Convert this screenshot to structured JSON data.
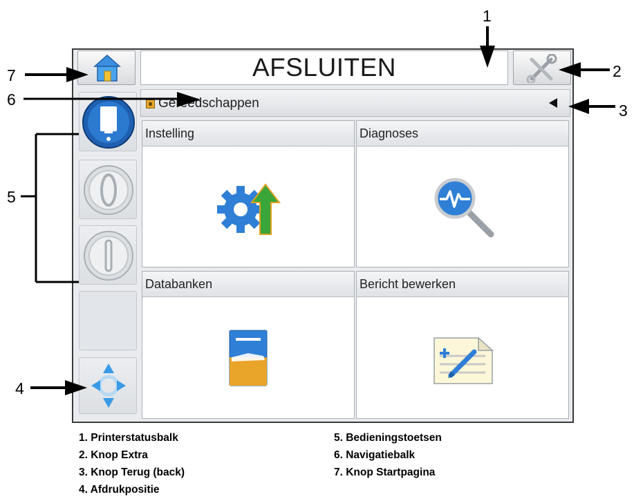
{
  "status_bar": {
    "title": "AFSLUITEN"
  },
  "nav_bar": {
    "breadcrumb": "Gereedschappen"
  },
  "tiles": [
    {
      "label": "Instelling"
    },
    {
      "label": "Diagnoses"
    },
    {
      "label": "Databanken"
    },
    {
      "label": "Bericht bewerken"
    }
  ],
  "callouts": [
    "1",
    "2",
    "3",
    "4",
    "5",
    "6",
    "7"
  ],
  "legend": [
    "1. Printerstatusbalk",
    "2. Knop Extra",
    "3. Knop Terug (back)",
    "4. Afdrukpositie",
    "5. Bedieningstoetsen",
    "6. Navigatiebalk",
    "7. Knop Startpagina"
  ],
  "icons": {
    "home": "home-icon",
    "tools": "tools-icon",
    "back": "back-arrow-icon",
    "folder": "folder-icon",
    "ink": "ink-drop-icon",
    "jet_start": "jet-start-icon",
    "jet_stop": "jet-stop-icon",
    "print_position": "print-position-icon",
    "setup": "gear-arrow-icon",
    "diagnostics": "magnifier-pulse-icon",
    "database": "database-cabinet-icon",
    "edit_message": "edit-message-icon"
  },
  "colors": {
    "accent_blue": "#2f7fd6",
    "arrow_green": "#3aa63a"
  }
}
